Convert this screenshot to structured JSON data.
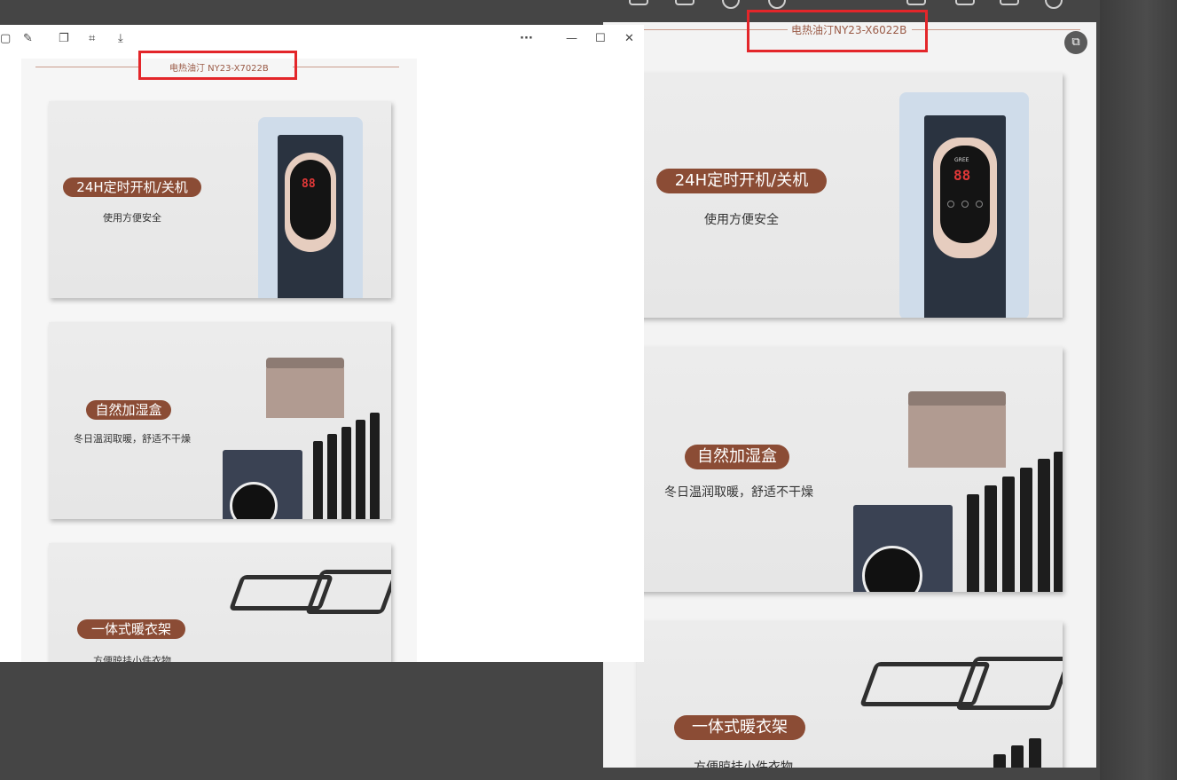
{
  "left_window": {
    "title": "电热油汀 NY23-X7022B",
    "toolbar_icons": [
      "square-icon",
      "edit-icon",
      "copy-icon",
      "scan-icon",
      "download-icon"
    ],
    "window_controls": {
      "more": "···",
      "minimize": "—",
      "maximize": "☐",
      "close": "✕"
    },
    "features": [
      {
        "heading": "24H定时开机/关机",
        "sub": "使用方便安全"
      },
      {
        "heading": "自然加湿盒",
        "sub": "冬日温润取暖，舒适不干燥"
      },
      {
        "heading": "一体式暖衣架",
        "sub": "方便晾挂小件衣物"
      }
    ]
  },
  "right_window": {
    "title": "电热油汀NY23-X6022B",
    "ocr_icon": "text-recognition-icon",
    "features": [
      {
        "heading": "24H定时开机/关机",
        "sub": "使用方便安全"
      },
      {
        "heading": "自然加湿盒",
        "sub": "冬日温润取暖，舒适不干燥"
      },
      {
        "heading": "一体式暖衣架",
        "sub": "方便晾挂小件衣物"
      }
    ]
  },
  "display": {
    "digits": "88",
    "brand": "GREE"
  },
  "colors": {
    "pill": "#8b4c35",
    "highlight": "#e3262a",
    "title": "#9a5a46"
  }
}
